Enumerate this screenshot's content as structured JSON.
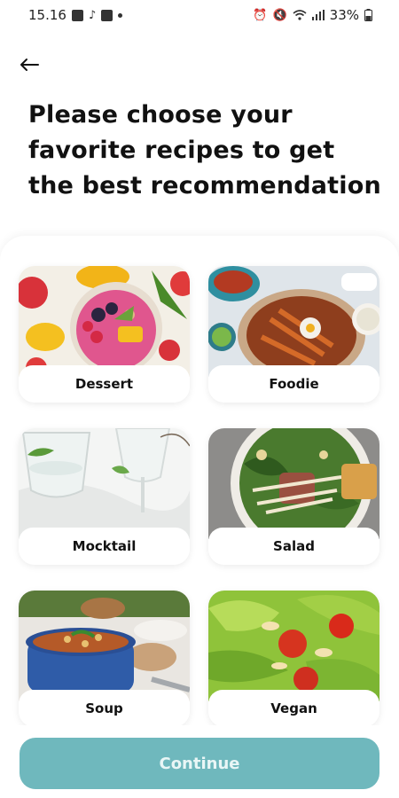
{
  "status_bar": {
    "time": "15.16",
    "battery": "33%"
  },
  "header": {
    "title": "Please choose your favorite recipes to get the best recommendation"
  },
  "categories": [
    {
      "label": "Dessert"
    },
    {
      "label": "Foodie"
    },
    {
      "label": "Mocktail"
    },
    {
      "label": "Salad"
    },
    {
      "label": "Soup"
    },
    {
      "label": "Vegan"
    }
  ],
  "footer": {
    "continue_label": "Continue"
  },
  "colors": {
    "accent": "#6fb8bd",
    "background": "#ffffff",
    "text": "#111111"
  }
}
